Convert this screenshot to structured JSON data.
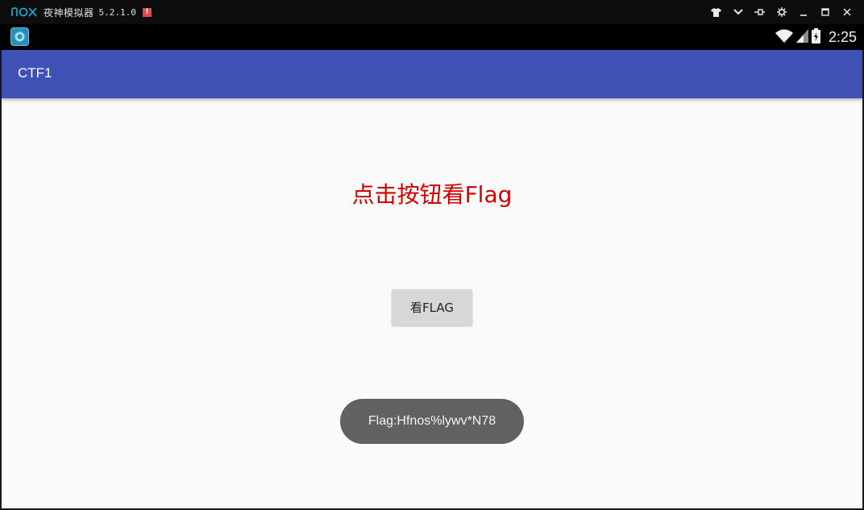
{
  "emulator": {
    "logo_text": "nox",
    "name": "夜神模拟器",
    "version": "5.2.1.0",
    "alert_badge": "!",
    "controls": [
      "shirt-icon",
      "chevron-down-icon",
      "pin-icon",
      "settings-icon",
      "minimize-icon",
      "maximize-icon",
      "close-icon"
    ]
  },
  "status_bar": {
    "time": "2:25"
  },
  "app": {
    "title": "CTF1",
    "headline": "点击按钮看Flag",
    "button_label": "看FLAG",
    "toast": "Flag:Hfnos%lywv*N78"
  },
  "colors": {
    "action_bar": "#3f51b5",
    "headline": "#d30000",
    "toast_bg": "#616161"
  }
}
